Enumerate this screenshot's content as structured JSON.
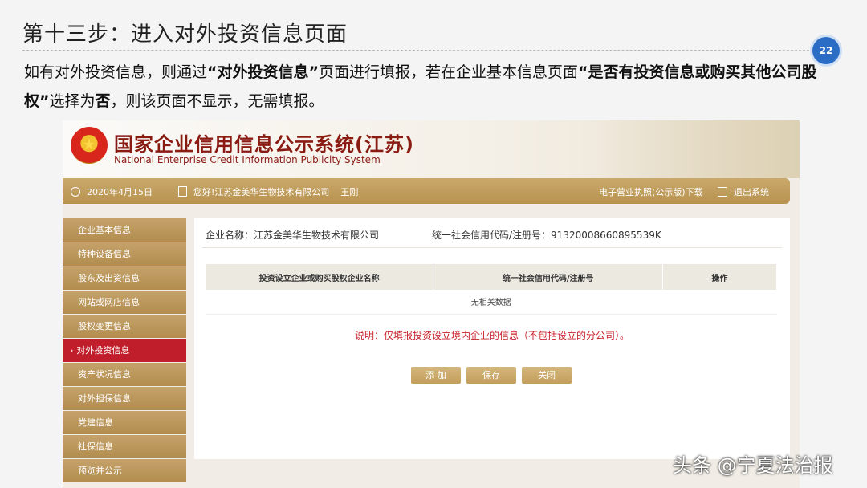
{
  "slide": {
    "title": "第十三步：进入对外投资信息页面",
    "page_number": "22",
    "desc_part1": "如有对外投资信息，则通过",
    "desc_bold1": "“对外投资信息”",
    "desc_part2": "页面进行填报，若在企业基本信息页面",
    "desc_bold2": "“是否有投资信息或购买其他公司股权”",
    "desc_part3": "选择为",
    "desc_bold3": "否",
    "desc_part4": "，则该页面不显示，无需填报。"
  },
  "site": {
    "title_cn": "国家企业信用信息公示系统(江苏)",
    "title_en": "National Enterprise Credit Information Publicity System"
  },
  "navbar": {
    "date": "2020年4月15日",
    "greeting": "您好!江苏金美华生物技术有限公司",
    "user": "王刚",
    "download_license": "电子营业执照(公示版)下载",
    "logout": "退出系统"
  },
  "sidebar": {
    "items": [
      {
        "label": "企业基本信息"
      },
      {
        "label": "特种设备信息"
      },
      {
        "label": "股东及出资信息"
      },
      {
        "label": "网站或网店信息"
      },
      {
        "label": "股权变更信息"
      },
      {
        "label": "对外投资信息"
      },
      {
        "label": "资产状况信息"
      },
      {
        "label": "对外担保信息"
      },
      {
        "label": "党建信息"
      },
      {
        "label": "社保信息"
      },
      {
        "label": "预览并公示"
      }
    ],
    "active_index": 5
  },
  "main": {
    "company_name": "企业名称：江苏金美华生物技术有限公司",
    "credit_code": "统一社会信用代码/注册号：91320008660895539K",
    "table": {
      "headers": [
        "投资设立企业或购买股权企业名称",
        "统一社会信用代码/注册号",
        "操作"
      ],
      "empty_text": "无相关数据"
    },
    "note": "说明：仅填报投资设立境内企业的信息（不包括设立的分公司）。",
    "buttons": {
      "add": "添 加",
      "save": "保存",
      "close": "关闭"
    }
  },
  "watermark": "头条 @宁夏法治报"
}
